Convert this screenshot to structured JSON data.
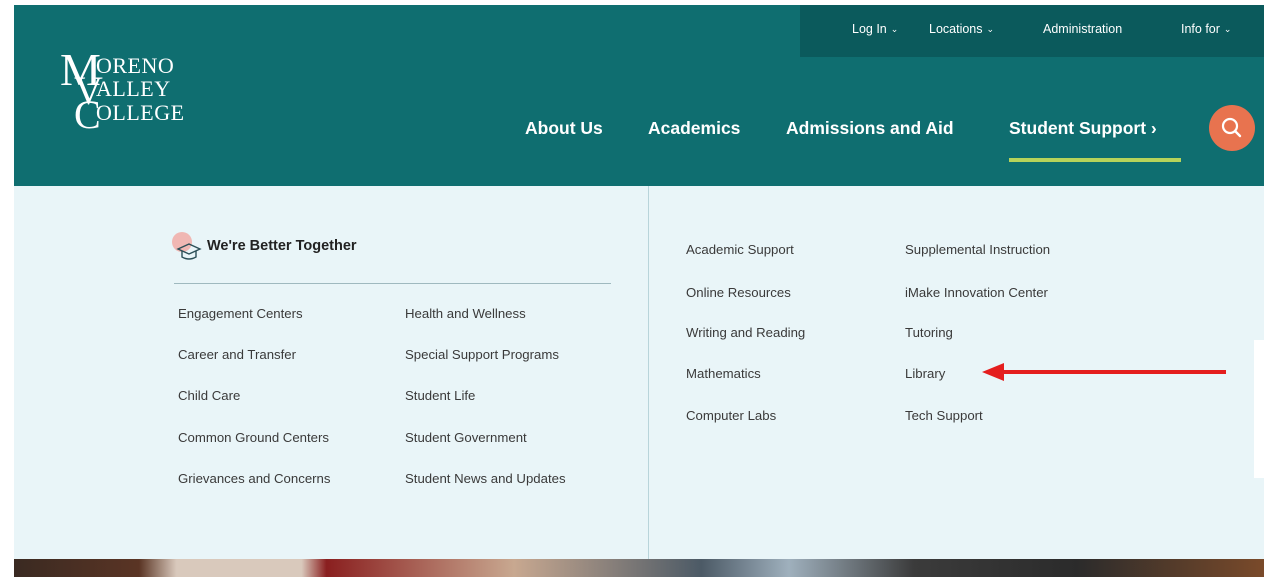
{
  "logo": {
    "line1": "ORENO",
    "line2": "ALLEY",
    "line3": "OLLEGE",
    "cap1": "M",
    "cap2": "V",
    "cap3": "C"
  },
  "utility_nav": [
    {
      "label": "Log In",
      "has_dropdown": true
    },
    {
      "label": "Locations",
      "has_dropdown": true
    },
    {
      "label": "Administration",
      "has_dropdown": false
    },
    {
      "label": "Info for",
      "has_dropdown": true
    }
  ],
  "main_nav": [
    {
      "label": "About Us"
    },
    {
      "label": "Academics"
    },
    {
      "label": "Admissions and Aid"
    },
    {
      "label": "Student Support ›",
      "active": true
    }
  ],
  "search": {
    "icon": "search-icon"
  },
  "dropdown": {
    "feature_title": "We're Better Together",
    "feature_icon": "graduation-cap-icon",
    "left_col1": [
      "Engagement Centers",
      "Career and Transfer",
      "Child Care",
      "Common Ground Centers",
      "Grievances and Concerns"
    ],
    "left_col2": [
      "Health and Wellness",
      "Special Support Programs",
      "Student Life",
      "Student Government",
      "Student News and Updates"
    ],
    "right_col1": [
      "Academic Support",
      "Online Resources",
      "Writing and Reading",
      "Mathematics",
      "Computer Labs"
    ],
    "right_col2": [
      "Supplemental Instruction",
      "iMake Innovation Center",
      "Tutoring",
      "Library",
      "Tech Support"
    ]
  },
  "annotation": {
    "arrow_color": "#e41e1e",
    "points_to": "Library"
  },
  "colors": {
    "header": "#0f6e70",
    "utility_bar": "#0b5a5c",
    "accent_underline": "#b7d35a",
    "search": "#e8734f",
    "panel": "#e9f5f8"
  }
}
